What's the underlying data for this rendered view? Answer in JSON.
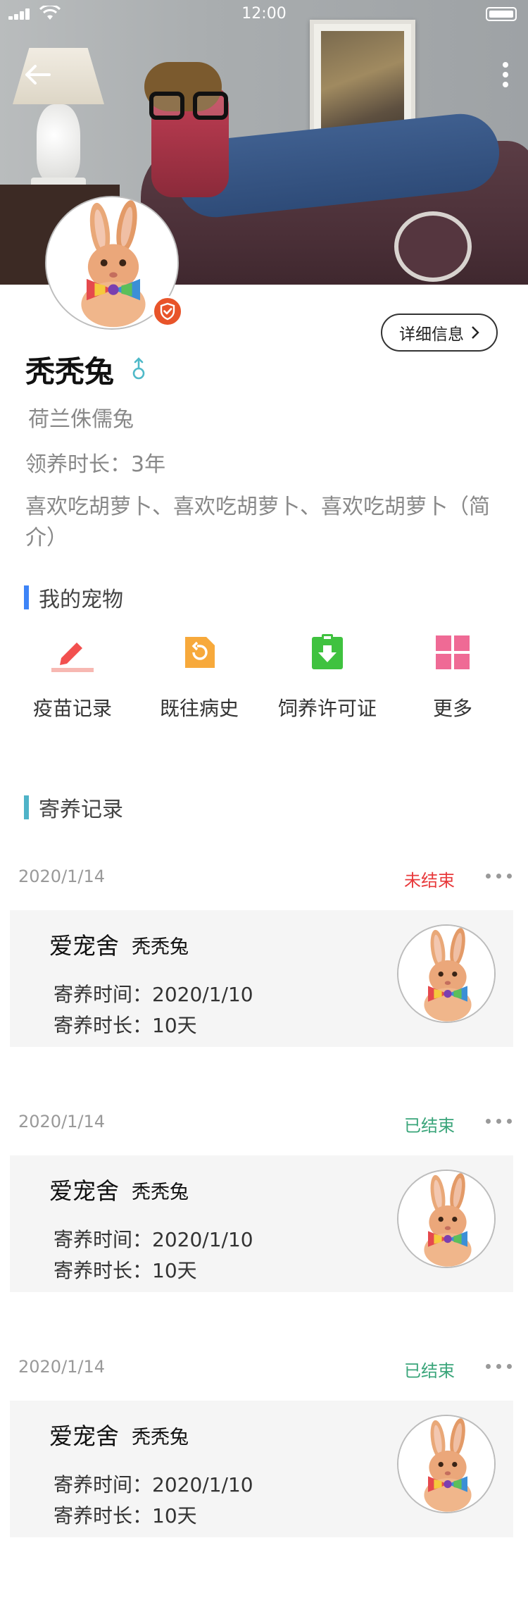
{
  "status_bar": {
    "time": "12:00"
  },
  "profile": {
    "name": "秃秃兔",
    "breed": "荷兰侏儒兔",
    "adopt_duration": "领养时长：3年",
    "intro": "喜欢吃胡萝卜、喜欢吃胡萝卜、喜欢吃胡萝卜（简介）",
    "detail_button": "详细信息"
  },
  "my_pets": {
    "title": "我的宠物",
    "bar_color": "#3d84f7",
    "actions": [
      {
        "label": "疫苗记录",
        "icon": "pencil-icon",
        "color": "#f2504f"
      },
      {
        "label": "既往病史",
        "icon": "history-file-icon",
        "color": "#f7a93b"
      },
      {
        "label": "饲养许可证",
        "icon": "license-download-icon",
        "color": "#3fc23f"
      },
      {
        "label": "更多",
        "icon": "grid-icon",
        "color": "#ef6a95"
      }
    ]
  },
  "boarding": {
    "title": "寄养记录",
    "bar_color": "#4fb3c8",
    "records": [
      {
        "date": "2020/1/14",
        "status": "未结束",
        "status_color": "#e8393b",
        "shop": "爱宠舍",
        "pet": "秃秃兔",
        "time": "寄养时间：2020/1/10",
        "duration": "寄养时长：10天"
      },
      {
        "date": "2020/1/14",
        "status": "已结束",
        "status_color": "#3aa57a",
        "shop": "爱宠舍",
        "pet": "秃秃兔",
        "time": "寄养时间：2020/1/10",
        "duration": "寄养时长：10天"
      },
      {
        "date": "2020/1/14",
        "status": "已结束",
        "status_color": "#3aa57a",
        "shop": "爱宠舍",
        "pet": "秃秃兔",
        "time": "寄养时间：2020/1/10",
        "duration": "寄养时长：10天"
      }
    ]
  }
}
